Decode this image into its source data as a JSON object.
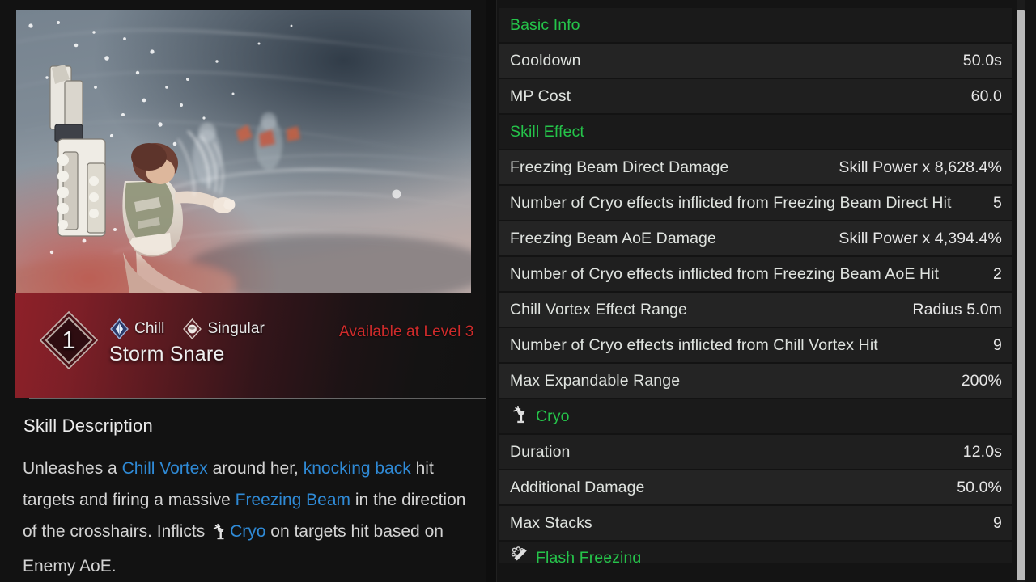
{
  "skill": {
    "level_badge": "1",
    "name": "Storm Snare",
    "availability": "Available at Level 3",
    "tags": [
      {
        "label": "Chill",
        "icon": "chill-diamond-icon"
      },
      {
        "label": "Singular",
        "icon": "singular-diamond-icon"
      }
    ],
    "description_title": "Skill Description",
    "description_parts": [
      {
        "text": "Unleashes a ",
        "type": "plain"
      },
      {
        "text": "Chill Vortex",
        "type": "keyword"
      },
      {
        "text": " around her, ",
        "type": "plain"
      },
      {
        "text": "knocking back",
        "type": "keyword"
      },
      {
        "text": " hit targets and firing a massive ",
        "type": "plain"
      },
      {
        "text": "Freezing Beam",
        "type": "keyword"
      },
      {
        "text": " in the direction of the crosshairs. Inflicts ",
        "type": "plain"
      },
      {
        "text": "Cryo",
        "type": "keyword-icon"
      },
      {
        "text": " on targets hit based on Enemy AoE.",
        "type": "plain"
      }
    ]
  },
  "stats": {
    "rows": [
      {
        "kind": "section",
        "label": "Basic Info",
        "icon": ""
      },
      {
        "kind": "stat",
        "label": "Cooldown",
        "value": "50.0s"
      },
      {
        "kind": "stat",
        "label": "MP Cost",
        "value": "60.0"
      },
      {
        "kind": "section",
        "label": "Skill Effect",
        "icon": ""
      },
      {
        "kind": "stat",
        "label": "Freezing Beam Direct Damage",
        "value": "Skill Power x 8,628.4%"
      },
      {
        "kind": "stat",
        "label": "Number of Cryo effects inflicted from Freezing Beam Direct Hit",
        "value": "5"
      },
      {
        "kind": "stat",
        "label": "Freezing Beam AoE Damage",
        "value": "Skill Power x 4,394.4%"
      },
      {
        "kind": "stat",
        "label": "Number of Cryo effects inflicted from Freezing Beam AoE Hit",
        "value": "2"
      },
      {
        "kind": "stat",
        "label": "Chill Vortex Effect Range",
        "value": "Radius 5.0m"
      },
      {
        "kind": "stat",
        "label": "Number of Cryo effects inflicted from Chill Vortex Hit",
        "value": "9"
      },
      {
        "kind": "stat",
        "label": "Max Expandable Range",
        "value": "200%"
      },
      {
        "kind": "section",
        "label": "Cryo",
        "icon": "cryo-icon"
      },
      {
        "kind": "stat",
        "label": "Duration",
        "value": "12.0s"
      },
      {
        "kind": "stat",
        "label": "Additional Damage",
        "value": "50.0%"
      },
      {
        "kind": "stat",
        "label": "Max Stacks",
        "value": "9"
      },
      {
        "kind": "section-clipped",
        "label": "Flash Freezing",
        "icon": "flash-freezing-icon"
      }
    ]
  },
  "colors": {
    "section_green": "#25c44a",
    "keyword_blue": "#2f8ad6",
    "availability_red": "#d02b2b",
    "header_red": "#8e2029"
  },
  "scrollbar": {
    "position": "right",
    "thumb_color": "#b9b9b9"
  }
}
